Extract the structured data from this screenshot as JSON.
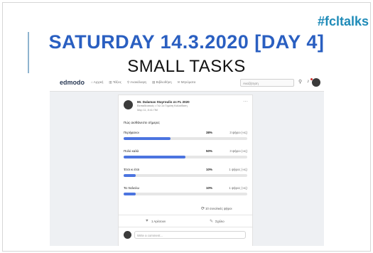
{
  "slide": {
    "hashtag": "#fcltalks",
    "title": "SATURDAY 14.3.2020 [DAY 4]",
    "subtitle": "SMALL TASKS"
  },
  "screenshot": {
    "logo": "edmodo",
    "nav_items": [
      "⌂ Αρχική",
      "▥ Τάξεις",
      "⚲ Ανακάλυψη",
      "▤ Βιβλιοθήκη",
      "✉ Μηνύματα"
    ],
    "search_placeholder": "Αναζήτηση",
    "post": {
      "author": "Mr. Dalamas Stayroulis σε FL 2020",
      "subinfo": "Εκπαιδευτικός • Γελ Σε Γεμάτη Καλινίδεση",
      "meta": "Μαρ 11, 8:41 ΠΜ",
      "question": "Πώς αισθάνεστε σήμερα;",
      "options": [
        {
          "label": "Περήφανοι",
          "percent": "38%",
          "percent_value": 38,
          "votes": "3 ψήφοι (-ες)"
        },
        {
          "label": "Πολύ καλά",
          "percent": "50%",
          "percent_value": 50,
          "votes": "3 ψήφοι (-ες)"
        },
        {
          "label": "Έτσι κι έτσι",
          "percent": "10%",
          "percent_value": 10,
          "votes": "1 ψήφος (-ες)"
        },
        {
          "label": "Τα παλεύω",
          "percent": "10%",
          "percent_value": 10,
          "votes": "1 ψήφος (-ες)"
        }
      ],
      "total_votes": "10 συνολικές ψήφοι",
      "like_label": "1 Αρέσουν",
      "comment_label": "Σχόλιο",
      "comment_placeholder": "Write a comment..."
    }
  }
}
